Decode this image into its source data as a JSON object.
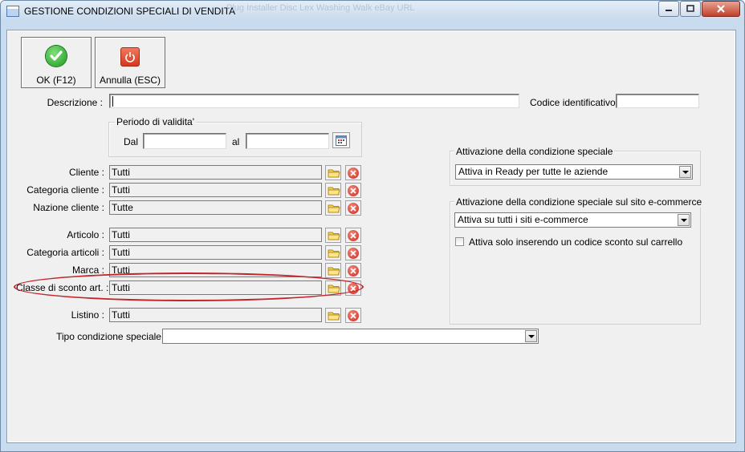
{
  "window": {
    "title": "GESTIONE CONDIZIONI SPECIALI DI VENDITA",
    "ghost_title": "Plug   Installer   Disc   Lex   Washing   Walk   eBay   URL"
  },
  "toolbar": {
    "ok_label": "OK (F12)",
    "cancel_label": "Annulla (ESC)"
  },
  "form": {
    "descrizione_label": "Descrizione :",
    "descrizione_value": "",
    "codice_label": "Codice identificativo :",
    "codice_value": "",
    "periodo": {
      "label": "Periodo di validita'",
      "dal_label": "Dal",
      "al_label": "al",
      "dal_value": "",
      "al_value": ""
    },
    "rows": [
      {
        "label": "Cliente :",
        "value": "Tutti"
      },
      {
        "label": "Categoria cliente :",
        "value": "Tutti"
      },
      {
        "label": "Nazione cliente :",
        "value": "Tutte"
      },
      {
        "label": "Articolo :",
        "value": "Tutti"
      },
      {
        "label": "Categoria articoli :",
        "value": "Tutti"
      },
      {
        "label": "Marca :",
        "value": "Tutti"
      },
      {
        "label": "Classe di sconto art. :",
        "value": "Tutti"
      },
      {
        "label": "Listino :",
        "value": "Tutti"
      }
    ],
    "tipo_label": "Tipo condizione speciale :",
    "tipo_value": ""
  },
  "attivazione": {
    "label": "Attivazione della condizione speciale",
    "value": "Attiva in Ready per tutte le aziende"
  },
  "ecommerce": {
    "label": "Attivazione della condizione speciale sul sito e-commerce",
    "value": "Attiva su tutti i siti e-commerce",
    "checkbox_label": "Attiva solo inserendo un codice sconto sul carrello",
    "checkbox_checked": false
  },
  "colors": {
    "highlight": "#c0262b",
    "title_bg": "#c7d9ec"
  }
}
